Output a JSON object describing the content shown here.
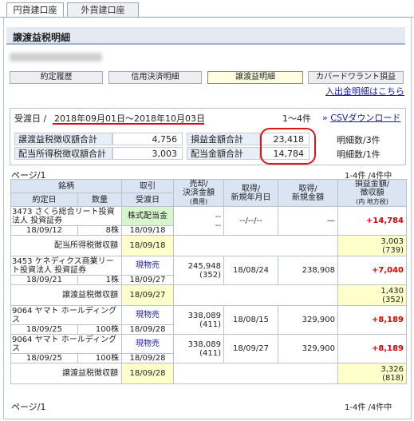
{
  "tabs": [
    "円貨建口座",
    "外貨建口座"
  ],
  "page_title": "譲渡益税明細",
  "nav": {
    "items": [
      "約定履歴",
      "信用決済明細",
      "譲渡益明細",
      "カバードワラント損益"
    ],
    "help": "入出金明細はこちら"
  },
  "summary": {
    "period_label": "受渡日",
    "period_sep": "/",
    "period_value": "2018年09月01日〜2018年10月03日",
    "range": "1〜4件",
    "csv": "CSVダウンロード",
    "csv_arrow": "»",
    "rows": [
      {
        "label": "譲渡益税徴収額合計",
        "value": "4,756",
        "label2": "損益金額合計",
        "value2": "23,418",
        "note": "明細数/3件"
      },
      {
        "label": "配当所得税徴収額合計",
        "value": "3,003",
        "label2": "配当金額合計",
        "value2": "14,784",
        "note": "明細数/1件"
      }
    ]
  },
  "page_label": "ページ/1",
  "count_label": "1-4件 /4件中",
  "table": {
    "headers": {
      "issue": "銘柄",
      "trade": "取引",
      "sale": [
        "売却/",
        "決済金額",
        "(費用)"
      ],
      "acq_date": [
        "取得/",
        "新規年月日"
      ],
      "acq_amount": [
        "取得/",
        "新規金額"
      ],
      "pl": [
        "損益金額/",
        "徴収額",
        "(内 地方税)"
      ],
      "contract_date": "約定日",
      "qty": "数量",
      "delivery": "受渡日"
    },
    "rows": [
      {
        "code": "3473",
        "name": "さくら総合リート投資法人 投資証券",
        "type": "株式配当金",
        "date": "18/09/12",
        "qty": "8株",
        "delivery": "18/09/18",
        "sale": "--",
        "sale2": "--",
        "acq_date": "--/--/--",
        "acq_amount": "—",
        "pl": "+14,784"
      },
      {
        "label": "配当所得税徴収額",
        "date": "18/09/18",
        "v1": "3,003",
        "v2": "(739)"
      },
      {
        "code": "3453",
        "name": "ケネディクス商業リート投資法人 投資証券",
        "type": "現物売",
        "date": "18/09/21",
        "qty": "1株",
        "delivery": "18/09/27",
        "sale": "245,948",
        "sale2": "(352)",
        "acq_date": "18/08/24",
        "acq_amount": "238,908",
        "pl": "+7,040"
      },
      {
        "label": "譲渡益税徴収額",
        "date": "18/09/27",
        "v1": "1,430",
        "v2": "(352)"
      },
      {
        "code": "9064",
        "name": "ヤマト ホールディングス",
        "type": "現物売",
        "date": "18/09/25",
        "qty": "100株",
        "delivery": "18/09/28",
        "sale": "338,089",
        "sale2": "(411)",
        "acq_date": "18/08/15",
        "acq_amount": "329,900",
        "pl": "+8,189"
      },
      {
        "code": "9064",
        "name": "ヤマト ホールディングス",
        "type": "現物売",
        "date": "18/09/25",
        "qty": "100株",
        "delivery": "18/09/28",
        "sale": "338,089",
        "sale2": "(411)",
        "acq_date": "18/09/27",
        "acq_amount": "329,900",
        "pl": "+8,189"
      },
      {
        "label": "譲渡益税徴収額",
        "date": "18/09/28",
        "v1": "3,326",
        "v2": "(818)"
      }
    ]
  },
  "colors": {
    "accent": "#1a1aa8",
    "profit": "#e00000",
    "highlight": "#ffffcc",
    "header": "#dbe4f3",
    "annotation": "#e01414"
  }
}
